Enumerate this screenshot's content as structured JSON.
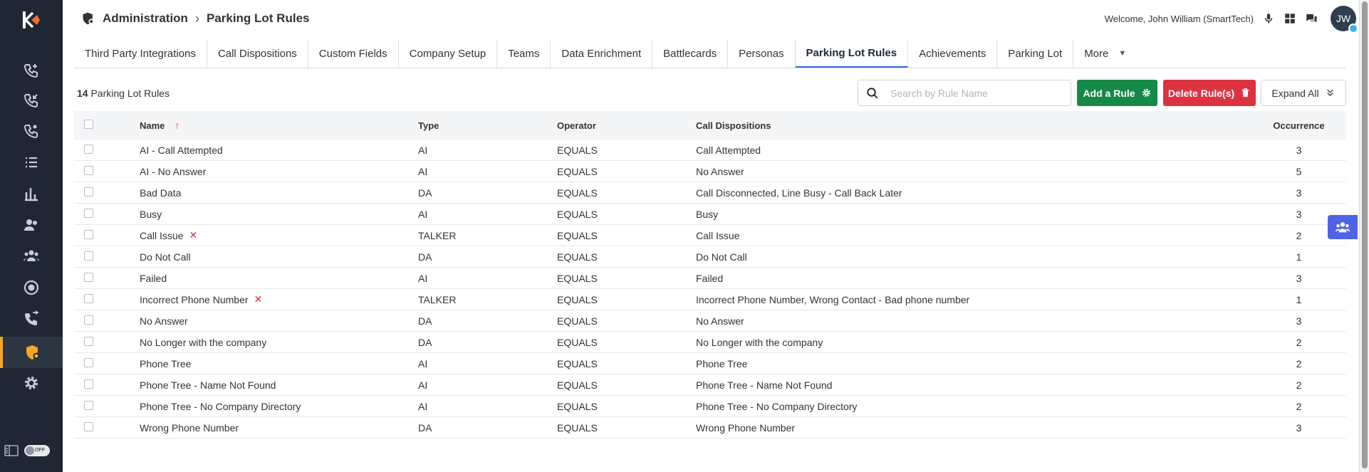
{
  "breadcrumb": {
    "section": "Administration",
    "page": "Parking Lot Rules"
  },
  "header": {
    "welcome": "Welcome, John William (SmartTech)",
    "avatar_initials": "JW"
  },
  "tabs": [
    {
      "label": "Third Party Integrations",
      "active": false
    },
    {
      "label": "Call Dispositions",
      "active": false
    },
    {
      "label": "Custom Fields",
      "active": false
    },
    {
      "label": "Company Setup",
      "active": false
    },
    {
      "label": "Teams",
      "active": false
    },
    {
      "label": "Data Enrichment",
      "active": false
    },
    {
      "label": "Battlecards",
      "active": false
    },
    {
      "label": "Personas",
      "active": false
    },
    {
      "label": "Parking Lot Rules",
      "active": true
    },
    {
      "label": "Achievements",
      "active": false
    },
    {
      "label": "Parking Lot",
      "active": false
    },
    {
      "label": "More",
      "active": false
    }
  ],
  "toolbar": {
    "count_number": "14",
    "count_label": "Parking Lot Rules",
    "search_placeholder": "Search by Rule Name",
    "add_label": "Add a Rule",
    "delete_label": "Delete Rule(s)",
    "expand_label": "Expand All"
  },
  "table": {
    "headers": {
      "name": "Name",
      "type": "Type",
      "operator": "Operator",
      "dispositions": "Call Dispositions",
      "occurrence": "Occurrence"
    },
    "rows": [
      {
        "name": "AI - Call Attempted",
        "type": "AI",
        "operator": "EQUALS",
        "dispositions": "Call Attempted",
        "occurrence": "3",
        "flag": false
      },
      {
        "name": "AI - No Answer",
        "type": "AI",
        "operator": "EQUALS",
        "dispositions": "No Answer",
        "occurrence": "5",
        "flag": false
      },
      {
        "name": "Bad Data",
        "type": "DA",
        "operator": "EQUALS",
        "dispositions": "Call Disconnected, Line Busy - Call Back Later",
        "occurrence": "3",
        "flag": false
      },
      {
        "name": "Busy",
        "type": "AI",
        "operator": "EQUALS",
        "dispositions": "Busy",
        "occurrence": "3",
        "flag": false
      },
      {
        "name": "Call Issue",
        "type": "TALKER",
        "operator": "EQUALS",
        "dispositions": "Call Issue",
        "occurrence": "2",
        "flag": true
      },
      {
        "name": "Do Not Call",
        "type": "DA",
        "operator": "EQUALS",
        "dispositions": "Do Not Call",
        "occurrence": "1",
        "flag": false
      },
      {
        "name": "Failed",
        "type": "AI",
        "operator": "EQUALS",
        "dispositions": "Failed",
        "occurrence": "3",
        "flag": false
      },
      {
        "name": "Incorrect Phone Number",
        "type": "TALKER",
        "operator": "EQUALS",
        "dispositions": "Incorrect Phone Number, Wrong Contact - Bad phone number",
        "occurrence": "1",
        "flag": true
      },
      {
        "name": "No Answer",
        "type": "DA",
        "operator": "EQUALS",
        "dispositions": "No Answer",
        "occurrence": "3",
        "flag": false
      },
      {
        "name": "No Longer with the company",
        "type": "DA",
        "operator": "EQUALS",
        "dispositions": "No Longer with the company",
        "occurrence": "2",
        "flag": false
      },
      {
        "name": "Phone Tree",
        "type": "AI",
        "operator": "EQUALS",
        "dispositions": "Phone Tree",
        "occurrence": "2",
        "flag": false
      },
      {
        "name": "Phone Tree - Name Not Found",
        "type": "AI",
        "operator": "EQUALS",
        "dispositions": "Phone Tree - Name Not Found",
        "occurrence": "2",
        "flag": false
      },
      {
        "name": "Phone Tree - No Company Directory",
        "type": "AI",
        "operator": "EQUALS",
        "dispositions": "Phone Tree - No Company Directory",
        "occurrence": "2",
        "flag": false
      },
      {
        "name": "Wrong Phone Number",
        "type": "DA",
        "operator": "EQUALS",
        "dispositions": "Wrong Phone Number",
        "occurrence": "3",
        "flag": false
      }
    ]
  },
  "sidebar_toggle": "OFF",
  "colors": {
    "sidebar": "#1e2733",
    "accent": "#f5a623",
    "add": "#168848",
    "delete": "#dd3340",
    "tab_active": "#2d6cdf",
    "float": "#4f63e6"
  },
  "icons": [
    "phone-plus-icon",
    "phone-incoming-icon",
    "phone-group-icon",
    "list-icon",
    "bar-chart-icon",
    "users-icon",
    "team-icon",
    "target-icon",
    "phone-forward-icon",
    "admin-shield-icon",
    "gear-icon"
  ]
}
